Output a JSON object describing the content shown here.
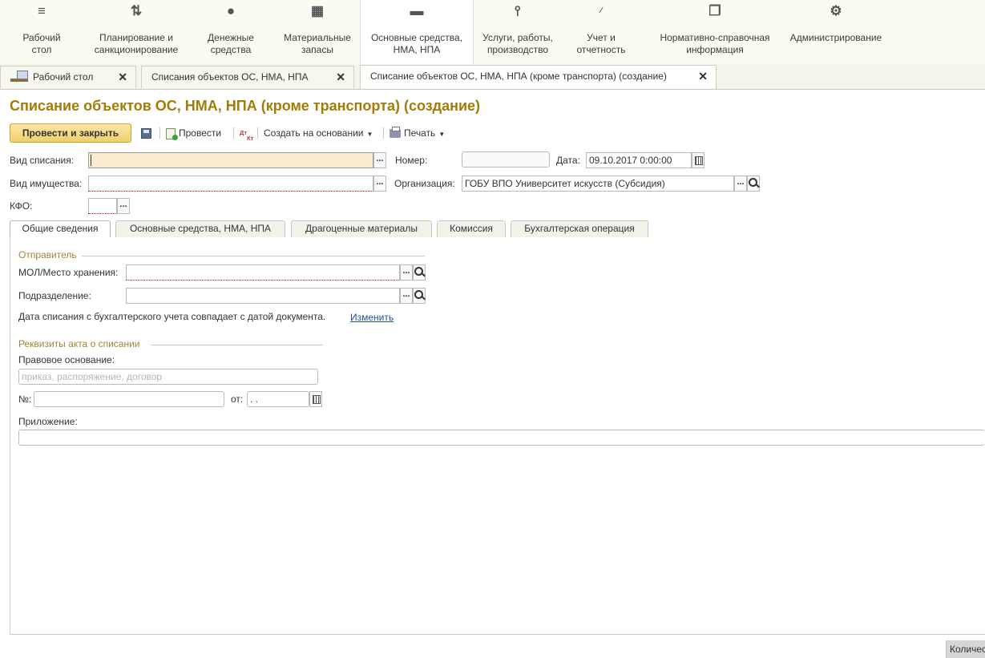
{
  "sections": [
    {
      "label": "Рабочий\nстол",
      "icon": "menu-lines-icon"
    },
    {
      "label": "Планирование и\nсанкционирование",
      "icon": "planning-icon"
    },
    {
      "label": "Денежные\nсредства",
      "icon": "ruble-coin-icon"
    },
    {
      "label": "Материальные\nзапасы",
      "icon": "inventory-grid-icon"
    },
    {
      "label": "Основные средства,\nНМА, НПА",
      "icon": "truck-icon"
    },
    {
      "label": "Услуги, работы,\nпроизводство",
      "icon": "tools-icon"
    },
    {
      "label": "Учет и\nотчетность",
      "icon": "dt-kt-icon"
    },
    {
      "label": "Нормативно-справочная\nинформация",
      "icon": "reference-book-icon"
    },
    {
      "label": "Администрирование",
      "icon": "gear-icon"
    }
  ],
  "open_tabs": [
    {
      "label": "Рабочий стол"
    },
    {
      "label": "Списания объектов ОС, НМА, НПА"
    },
    {
      "label": "Списание объектов ОС, НМА, НПА (кроме транспорта) (создание)"
    }
  ],
  "form": {
    "title": "Списание объектов ОС, НМА, НПА (кроме транспорта) (создание)",
    "toolbar": {
      "post_close": "Провести и закрыть",
      "post": "Провести",
      "dt": "Дт",
      "kt": "Кт",
      "create_based": "Создать на основании",
      "print": "Печать"
    },
    "fields": {
      "write_off_type_label": "Вид списания:",
      "write_off_type_value": "",
      "number_label": "Номер:",
      "number_value": "",
      "date_label": "Дата:",
      "date_value": "09.10.2017  0:00:00",
      "property_type_label": "Вид имущества:",
      "property_type_value": "",
      "organization_label": "Организация:",
      "organization_value": "ГОБУ ВПО Университет искусств (Субсидия)",
      "kfo_label": "КФО:",
      "kfo_value": ""
    },
    "tabs": [
      {
        "label": "Общие сведения"
      },
      {
        "label": "Основные средства, НМА, НПА"
      },
      {
        "label": "Драгоценные материалы"
      },
      {
        "label": "Комиссия"
      },
      {
        "label": "Бухгалтерская операция"
      }
    ],
    "general": {
      "sender_group": "Отправитель",
      "mol_label": "МОЛ/Место хранения:",
      "mol_value": "",
      "department_label": "Подразделение:",
      "department_value": "",
      "date_note": "Дата списания с бухгалтерского учета совпадает с датой документа.",
      "change_link": "Изменить",
      "act_group": "Реквизиты акта о списании",
      "legal_basis_label": "Правовое основание:",
      "legal_basis_placeholder": "приказ, распоряжение, договор",
      "number_label": "№:",
      "number_value": "",
      "from_label": "от:",
      "from_value": " .  .",
      "attachment_label": "Приложение:",
      "attachment_value": ""
    }
  },
  "status_corner": "Количес"
}
